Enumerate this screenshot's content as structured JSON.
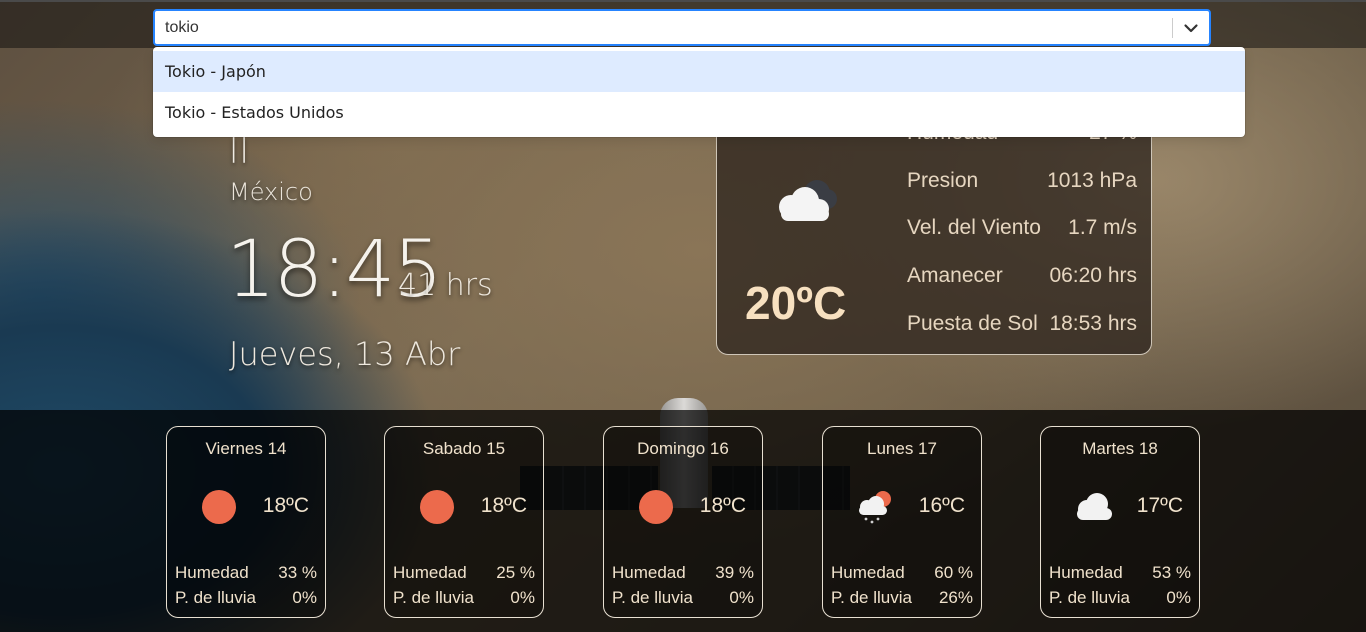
{
  "search": {
    "value": "tokio",
    "options": [
      "Tokio - Japón",
      "Tokio - Estados Unidos"
    ]
  },
  "clock": {
    "city_partial": "ll",
    "country": "México",
    "time": "18:45",
    "suffix": "41 hrs",
    "date": "Jueves, 13 Abr"
  },
  "current": {
    "temp": "20ºC",
    "icon": "cloudy-icon",
    "stats": [
      {
        "label": "Humedad",
        "value": "27 %"
      },
      {
        "label": "Presion",
        "value": "1013 hPa"
      },
      {
        "label": "Vel. del Viento",
        "value": "1.7 m/s"
      },
      {
        "label": "Amanecer",
        "value": "06:20 hrs"
      },
      {
        "label": "Puesta de Sol",
        "value": "18:53 hrs"
      }
    ]
  },
  "forecast_labels": {
    "humidity": "Humedad",
    "rain": "P. de lluvia"
  },
  "forecast": [
    {
      "day": "Viernes 14",
      "temp": "18ºC",
      "icon": "sun-icon",
      "humidity": "33 %",
      "rain": "0%"
    },
    {
      "day": "Sabado 15",
      "temp": "18ºC",
      "icon": "sun-icon",
      "humidity": "25 %",
      "rain": "0%"
    },
    {
      "day": "Domingo 16",
      "temp": "18ºC",
      "icon": "sun-icon",
      "humidity": "39 %",
      "rain": "0%"
    },
    {
      "day": "Lunes 17",
      "temp": "16ºC",
      "icon": "rain-sun-icon",
      "humidity": "60 %",
      "rain": "26%"
    },
    {
      "day": "Martes 18",
      "temp": "17ºC",
      "icon": "cloud-icon",
      "humidity": "53 %",
      "rain": "0%"
    }
  ],
  "colors": {
    "accent": "#2684ff",
    "sun": "#ec6a4c",
    "text_warm": "#f0e2cc"
  }
}
